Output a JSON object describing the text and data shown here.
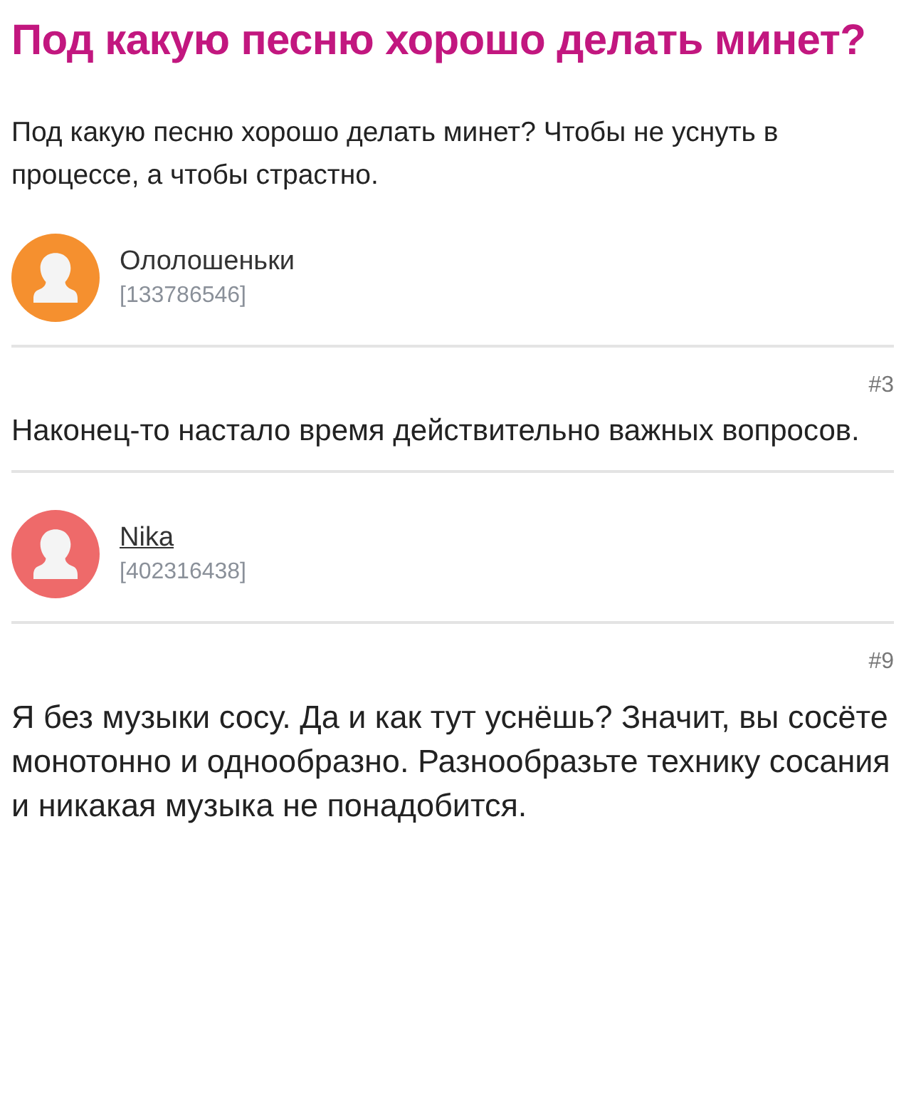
{
  "question": {
    "title": "Под какую песню хорошо делать минет?",
    "text": "Под какую песню хорошо делать минет? Чтобы не уснуть в процессе, а чтобы страстно."
  },
  "feed": [
    {
      "kind": "author",
      "name": "Ололошеньки",
      "id": "[133786546]",
      "color": "#f5902f",
      "underlined": false
    },
    {
      "kind": "answer",
      "number": "#3",
      "text": "Наконец-то настало время действительно важных вопросов."
    },
    {
      "kind": "author",
      "name": "Nika",
      "id": "[402316438]",
      "color": "#ee6a6a",
      "underlined": true
    },
    {
      "kind": "answer",
      "number": "#9",
      "text": "Я без музыки сосу. Да и как тут уснёшь? Значит, вы сосёте монотонно и однообразно. Разнообразьте технику сосания и никакая музыка не понадобится."
    }
  ]
}
